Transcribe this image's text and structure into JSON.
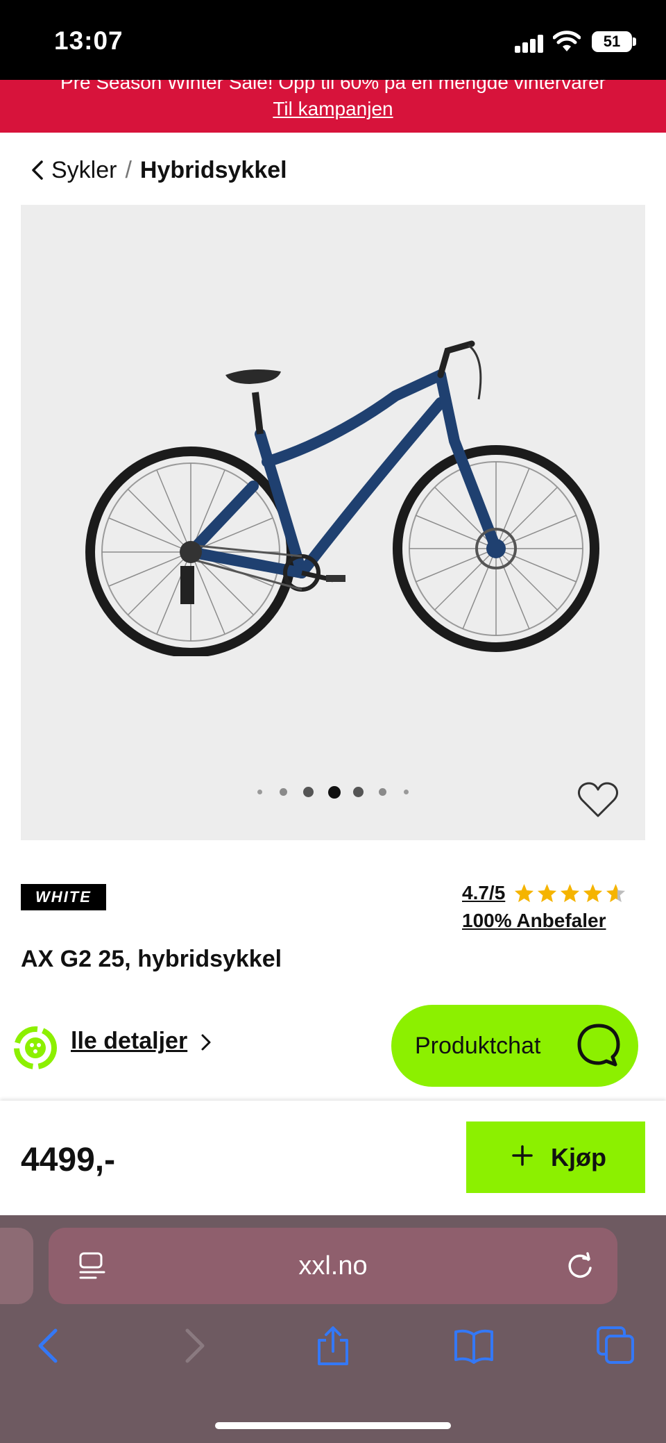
{
  "status_bar": {
    "time": "13:07",
    "battery": "51"
  },
  "promo": {
    "text": "Pre Season Winter Sale! Opp til 60% på en mengde vintervarer",
    "link": "Til kampanjen",
    "color": "#d7133b"
  },
  "breadcrumb": {
    "parent": "Sykler",
    "separator": "/",
    "current": "Hybridsykkel"
  },
  "gallery": {
    "image": "bike-photo",
    "dot_count": 7,
    "active_dot": 4
  },
  "product": {
    "brand": "WHITE",
    "rating": "4.7/5",
    "rating_value": 4.7,
    "recommend": "100% Anbefaler",
    "title": "AX G2 25, hybridsykkel",
    "details_link": "lle detaljer"
  },
  "chat": {
    "label": "Produktchat",
    "color": "#8cf000"
  },
  "buy_bar": {
    "price": "4499,-",
    "buy_label": "Kjøp"
  },
  "browser": {
    "url": "xxl.no",
    "accent": "#3478f6"
  },
  "icons": [
    "back-chevron-icon",
    "heart-icon",
    "star-icon",
    "eco-badge-icon",
    "chat-bubble-icon",
    "plus-icon",
    "reader-icon",
    "reload-icon",
    "browser-back-icon",
    "browser-forward-icon",
    "share-icon",
    "bookmarks-icon",
    "tabs-icon"
  ]
}
